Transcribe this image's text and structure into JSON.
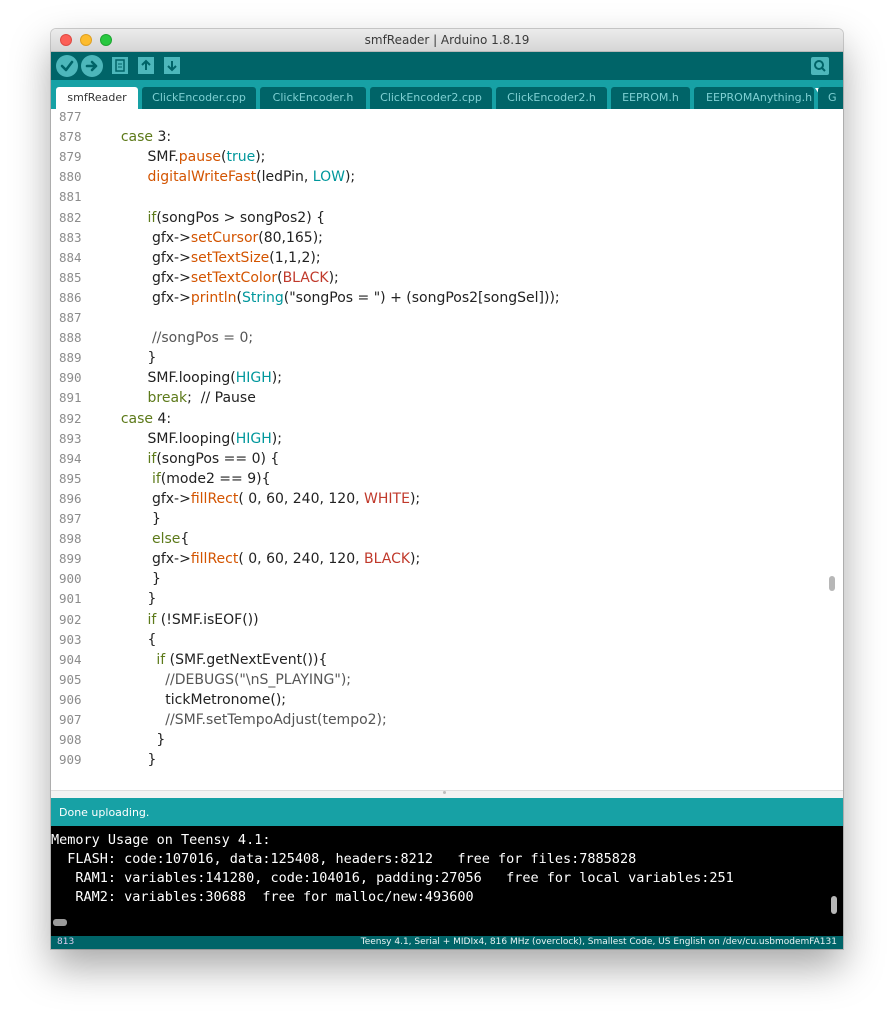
{
  "window": {
    "title": "smfReader | Arduino 1.8.19"
  },
  "toolbar": {
    "buttons": [
      {
        "name": "verify",
        "icon": "check-icon"
      },
      {
        "name": "upload",
        "icon": "arrow-right-icon"
      },
      {
        "name": "new",
        "icon": "new-file-icon"
      },
      {
        "name": "open",
        "icon": "arrow-up-icon"
      },
      {
        "name": "save",
        "icon": "arrow-down-icon"
      }
    ],
    "serial_monitor_icon": "magnifier-icon"
  },
  "tabs": [
    {
      "label": "smfReader",
      "active": true
    },
    {
      "label": "ClickEncoder.cpp"
    },
    {
      "label": "ClickEncoder.h"
    },
    {
      "label": "ClickEncoder2.cpp"
    },
    {
      "label": "ClickEncoder2.h"
    },
    {
      "label": "EEPROM.h"
    },
    {
      "label": "EEPROMAnything.h"
    },
    {
      "label": "G"
    }
  ],
  "editor": {
    "lines": [
      {
        "n": "877",
        "segs": []
      },
      {
        "n": "878",
        "segs": [
          {
            "t": "    "
          },
          {
            "t": "case",
            "c": "kw"
          },
          {
            "t": " 3:"
          }
        ]
      },
      {
        "n": "879",
        "segs": [
          {
            "t": "          SMF."
          },
          {
            "t": "pause",
            "c": "fn"
          },
          {
            "t": "("
          },
          {
            "t": "true",
            "c": "const"
          },
          {
            "t": ");"
          }
        ]
      },
      {
        "n": "880",
        "segs": [
          {
            "t": "          "
          },
          {
            "t": "digitalWriteFast",
            "c": "fn"
          },
          {
            "t": "(ledPin, "
          },
          {
            "t": "LOW",
            "c": "const"
          },
          {
            "t": ");"
          }
        ]
      },
      {
        "n": "881",
        "segs": []
      },
      {
        "n": "882",
        "segs": [
          {
            "t": "          "
          },
          {
            "t": "if",
            "c": "kw"
          },
          {
            "t": "(songPos > songPos2) {"
          }
        ]
      },
      {
        "n": "883",
        "segs": [
          {
            "t": "           gfx->"
          },
          {
            "t": "setCursor",
            "c": "fn"
          },
          {
            "t": "(80,165);"
          }
        ]
      },
      {
        "n": "884",
        "segs": [
          {
            "t": "           gfx->"
          },
          {
            "t": "setTextSize",
            "c": "fn"
          },
          {
            "t": "(1,1,2);"
          }
        ]
      },
      {
        "n": "885",
        "segs": [
          {
            "t": "           gfx->"
          },
          {
            "t": "setTextColor",
            "c": "fn"
          },
          {
            "t": "("
          },
          {
            "t": "BLACK",
            "c": "red"
          },
          {
            "t": ");"
          }
        ]
      },
      {
        "n": "886",
        "segs": [
          {
            "t": "           gfx->"
          },
          {
            "t": "println",
            "c": "fn"
          },
          {
            "t": "("
          },
          {
            "t": "String",
            "c": "const"
          },
          {
            "t": "(\"songPos = \") + (songPos2[songSel]));"
          }
        ]
      },
      {
        "n": "887",
        "segs": []
      },
      {
        "n": "888",
        "segs": [
          {
            "t": "           //songPos = 0;",
            "c": "cmt"
          }
        ]
      },
      {
        "n": "889",
        "segs": [
          {
            "t": "          }"
          }
        ]
      },
      {
        "n": "890",
        "segs": [
          {
            "t": "          SMF.looping("
          },
          {
            "t": "HIGH",
            "c": "const"
          },
          {
            "t": ");"
          }
        ]
      },
      {
        "n": "891",
        "segs": [
          {
            "t": "          "
          },
          {
            "t": "break",
            "c": "kw"
          },
          {
            "t": ";  // Pause"
          }
        ]
      },
      {
        "n": "892",
        "segs": [
          {
            "t": "    "
          },
          {
            "t": "case",
            "c": "kw"
          },
          {
            "t": " 4:"
          }
        ]
      },
      {
        "n": "893",
        "segs": [
          {
            "t": "          SMF.looping("
          },
          {
            "t": "HIGH",
            "c": "const"
          },
          {
            "t": ");"
          }
        ]
      },
      {
        "n": "894",
        "segs": [
          {
            "t": "          "
          },
          {
            "t": "if",
            "c": "kw"
          },
          {
            "t": "(songPos == 0) {"
          }
        ]
      },
      {
        "n": "895",
        "segs": [
          {
            "t": "           "
          },
          {
            "t": "if",
            "c": "kw"
          },
          {
            "t": "(mode2 == 9){"
          }
        ]
      },
      {
        "n": "896",
        "segs": [
          {
            "t": "           gfx->"
          },
          {
            "t": "fillRect",
            "c": "fn"
          },
          {
            "t": "( 0, 60, 240, 120, "
          },
          {
            "t": "WHITE",
            "c": "red"
          },
          {
            "t": ");"
          }
        ]
      },
      {
        "n": "897",
        "segs": [
          {
            "t": "           }"
          }
        ]
      },
      {
        "n": "898",
        "segs": [
          {
            "t": "           "
          },
          {
            "t": "else",
            "c": "kw"
          },
          {
            "t": "{"
          }
        ]
      },
      {
        "n": "899",
        "segs": [
          {
            "t": "           gfx->"
          },
          {
            "t": "fillRect",
            "c": "fn"
          },
          {
            "t": "( 0, 60, 240, 120, "
          },
          {
            "t": "BLACK",
            "c": "red"
          },
          {
            "t": ");"
          }
        ]
      },
      {
        "n": "900",
        "segs": [
          {
            "t": "           }"
          }
        ]
      },
      {
        "n": "901",
        "segs": [
          {
            "t": "          }"
          }
        ]
      },
      {
        "n": "902",
        "segs": [
          {
            "t": "          "
          },
          {
            "t": "if",
            "c": "kw"
          },
          {
            "t": " (!SMF.isEOF())"
          }
        ]
      },
      {
        "n": "903",
        "segs": [
          {
            "t": "          {"
          }
        ]
      },
      {
        "n": "904",
        "segs": [
          {
            "t": "            "
          },
          {
            "t": "if",
            "c": "kw"
          },
          {
            "t": " (SMF.getNextEvent()){"
          }
        ]
      },
      {
        "n": "905",
        "segs": [
          {
            "t": "              //DEBUGS(\"\\nS_PLAYING\");",
            "c": "cmt"
          }
        ]
      },
      {
        "n": "906",
        "segs": [
          {
            "t": "              tickMetronome();"
          }
        ]
      },
      {
        "n": "907",
        "segs": [
          {
            "t": "              //SMF.setTempoAdjust(tempo2);",
            "c": "cmt"
          }
        ]
      },
      {
        "n": "908",
        "segs": [
          {
            "t": "            }"
          }
        ]
      },
      {
        "n": "909",
        "segs": [
          {
            "t": "          }"
          }
        ]
      }
    ]
  },
  "status": {
    "message": "Done uploading."
  },
  "console": {
    "lines": [
      "Memory Usage on Teensy 4.1:",
      "  FLASH: code:107016, data:125408, headers:8212   free for files:7885828",
      "   RAM1: variables:141280, code:104016, padding:27056   free for local variables:251",
      "   RAM2: variables:30688  free for malloc/new:493600"
    ]
  },
  "bottombar": {
    "line_number": "813",
    "board_info": "Teensy 4.1, Serial + MIDIx4, 816 MHz (overclock), Smallest Code, US English on /dev/cu.usbmodemFA131"
  },
  "colors": {
    "keyword": "#5d7a1a",
    "function": "#d35400",
    "constant": "#00979c",
    "red": "#c0392b",
    "comment": "#555555",
    "toolbar": "#006468",
    "tabbar": "#17a1a5"
  }
}
